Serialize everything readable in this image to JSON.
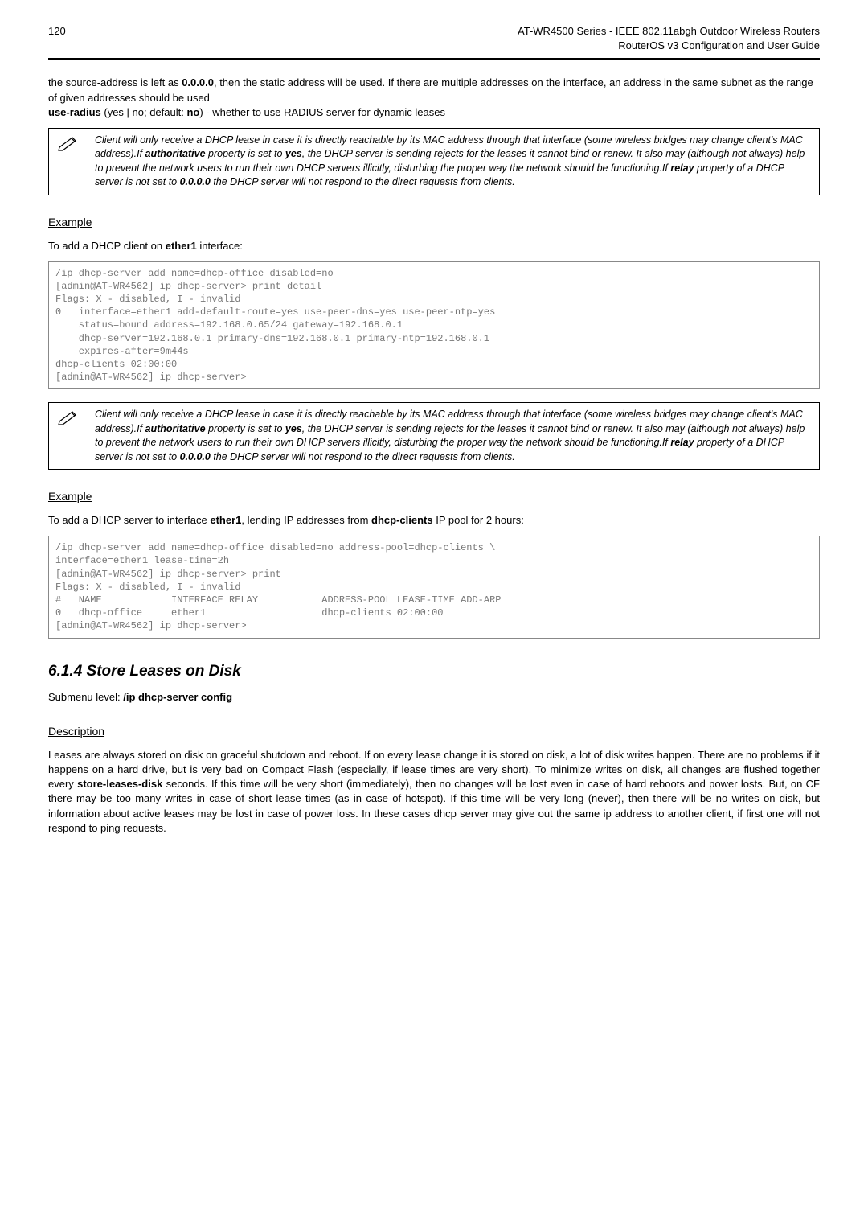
{
  "header": {
    "page": "120",
    "line1": "AT-WR4500 Series - IEEE 802.11abgh Outdoor Wireless Routers",
    "line2": "RouterOS v3 Configuration and User Guide"
  },
  "intro_parts": {
    "p1a": "the source-address is left as ",
    "p1b": "0.0.0.0",
    "p1c": ", then the static address will be used. If there are multiple addresses on the interface, an address in the same subnet as the range of given addresses should be used",
    "p2a": "use-radius",
    "p2b": " (yes | no; default: ",
    "p2c": "no",
    "p2d": ") - whether to use RADIUS server for dynamic leases"
  },
  "note_icon": "✎",
  "note1": {
    "a": "Client will only receive a DHCP lease in case it is directly reachable by its MAC address through that interface (some wireless bridges may change client's MAC address).If ",
    "b": "authoritative",
    "c": " property is set to ",
    "d": "yes",
    "e": ", the DHCP server is sending rejects for the leases it cannot bind or renew. It also may (although not always) help to prevent the network users to run their own DHCP servers illicitly, disturbing the proper way the network should be functioning.If ",
    "f": "relay",
    "g": " property of a DHCP server is not set to ",
    "h": "0.0.0.0",
    "i": " the DHCP server will not respond to the direct requests from clients."
  },
  "example1": {
    "heading": "Example",
    "lead_a": "To add a DHCP client on ",
    "lead_b": "ether1",
    "lead_c": " interface:",
    "code": "/ip dhcp-server add name=dhcp-office disabled=no\n[admin@AT-WR4562] ip dhcp-server> print detail\nFlags: X - disabled, I - invalid\n0   interface=ether1 add-default-route=yes use-peer-dns=yes use-peer-ntp=yes\n    status=bound address=192.168.0.65/24 gateway=192.168.0.1\n    dhcp-server=192.168.0.1 primary-dns=192.168.0.1 primary-ntp=192.168.0.1\n    expires-after=9m44s\ndhcp-clients 02:00:00\n[admin@AT-WR4562] ip dhcp-server>"
  },
  "example2": {
    "heading": "Example",
    "lead_a": "To add a DHCP server to interface ",
    "lead_b": "ether1",
    "lead_c": ", lending IP addresses from ",
    "lead_d": "dhcp-clients",
    "lead_e": " IP pool for 2 hours:",
    "code": "/ip dhcp-server add name=dhcp-office disabled=no address-pool=dhcp-clients \\\ninterface=ether1 lease-time=2h\n[admin@AT-WR4562] ip dhcp-server> print\nFlags: X - disabled, I - invalid\n#   NAME            INTERFACE RELAY           ADDRESS-POOL LEASE-TIME ADD-ARP\n0   dhcp-office     ether1                    dhcp-clients 02:00:00\n[admin@AT-WR4562] ip dhcp-server>"
  },
  "store": {
    "heading": "6.1.4  Store Leases on Disk",
    "sub_a": "Submenu level: ",
    "sub_b": "/ip dhcp-server config",
    "desc_heading": "Description",
    "desc_a": "Leases are always stored on disk on graceful shutdown and reboot. If on every lease change it is stored on disk, a lot of disk writes happen. There are no problems if it happens on a hard drive, but is very bad on Compact Flash (especially, if lease times are very short). To minimize writes on disk, all changes are flushed together every ",
    "desc_b": "store-leases-disk",
    "desc_c": " seconds. If this time will be very short (immediately), then no changes will be lost even in case of hard reboots and power losts. But, on CF there may be too many writes in case of short lease times (as in case of hotspot). If this time will be very long (never), then there will be no writes on disk, but information about active leases may be lost in case of power loss. In these cases dhcp server may give out the same ip address to another client, if first one will not respond to ping requests."
  }
}
